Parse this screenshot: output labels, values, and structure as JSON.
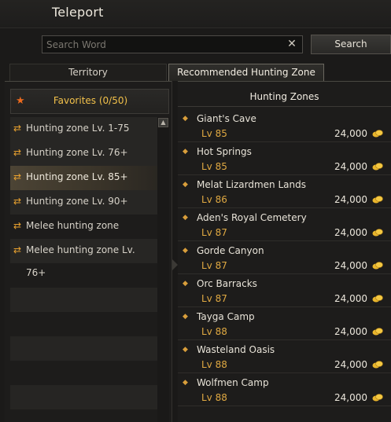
{
  "window": {
    "title": "Teleport"
  },
  "search": {
    "placeholder": "Search Word",
    "value": "",
    "clear_glyph": "✕",
    "button_label": "Search"
  },
  "tabs": [
    {
      "label": "Territory",
      "active": false
    },
    {
      "label": "Recommended Hunting Zone",
      "active": true
    }
  ],
  "favorites": {
    "label": "Favorites (0/50)",
    "icon": "star-icon"
  },
  "left_list": {
    "items": [
      {
        "label": "Hunting zone Lv. 1-75",
        "icon": "zone-icon",
        "selected": false
      },
      {
        "label": "Hunting zone Lv. 76+",
        "icon": "zone-icon",
        "selected": false
      },
      {
        "label": "Hunting zone Lv. 85+",
        "icon": "zone-icon",
        "selected": true
      },
      {
        "label": "Hunting zone Lv. 90+",
        "icon": "zone-icon",
        "selected": false
      },
      {
        "label": "Melee hunting zone",
        "icon": "zone-icon",
        "selected": false
      },
      {
        "label": "Melee hunting zone Lv. 76+",
        "icon": "zone-icon",
        "selected": false
      }
    ]
  },
  "right_panel": {
    "header": "Hunting Zones",
    "zones": [
      {
        "name": "Giant's Cave",
        "level": "Lv 85",
        "cost": "24,000"
      },
      {
        "name": "Hot Springs",
        "level": "Lv 85",
        "cost": "24,000"
      },
      {
        "name": "Melat Lizardmen Lands",
        "level": "Lv 86",
        "cost": "24,000"
      },
      {
        "name": "Aden's Royal Cemetery",
        "level": "Lv 87",
        "cost": "24,000"
      },
      {
        "name": "Gorde Canyon",
        "level": "Lv 87",
        "cost": "24,000"
      },
      {
        "name": "Orc Barracks",
        "level": "Lv 87",
        "cost": "24,000"
      },
      {
        "name": "Tayga Camp",
        "level": "Lv 88",
        "cost": "24,000"
      },
      {
        "name": "Wasteland Oasis",
        "level": "Lv 88",
        "cost": "24,000"
      },
      {
        "name": "Wolfmen Camp",
        "level": "Lv 88",
        "cost": "24,000"
      }
    ]
  },
  "colors": {
    "accent_gold": "#e0a942",
    "favorites_text": "#f2c14a",
    "star": "#ee6b1e",
    "coin": "#e9b52c"
  }
}
